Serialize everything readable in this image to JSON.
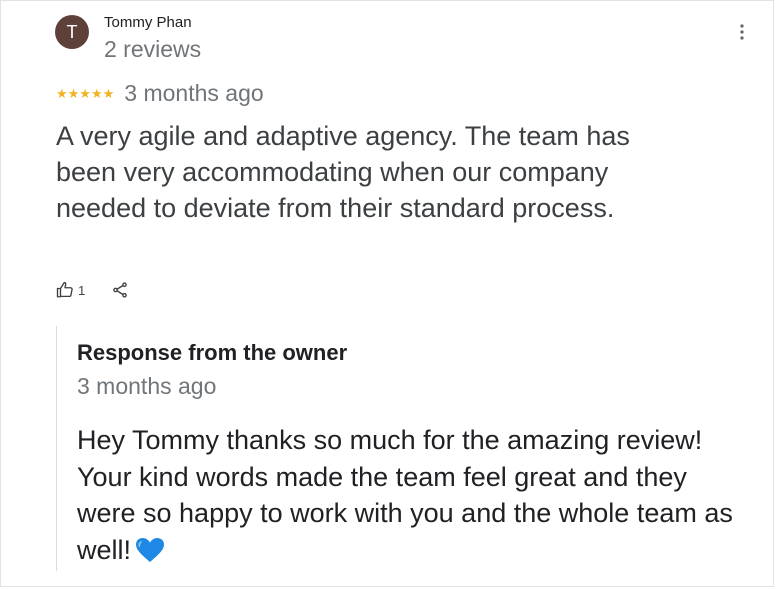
{
  "review": {
    "avatar_letter": "T",
    "author": "Tommy Phan",
    "reviews_count": "2 reviews",
    "rating_stars": "★★★★★",
    "rating_value": 5,
    "date": "3 months ago",
    "text": "A very agile and adaptive agency. The team has been very accommodating when our company needed to deviate from their standard process.",
    "likes": "1",
    "more_icon": "more-vert-icon",
    "like_icon": "thumb-up-icon",
    "share_icon": "share-icon"
  },
  "response": {
    "title": "Response from the owner",
    "date": "3 months ago",
    "text": "Hey Tommy thanks so much for the amazing review! Your kind words made the team feel great and they were so happy to work with you and the whole team as well!",
    "emoji": "💙"
  },
  "colors": {
    "avatar": "#5d4037",
    "stars": "#f0b323",
    "muted_text": "#70757a",
    "heart": "#1e88e5"
  }
}
